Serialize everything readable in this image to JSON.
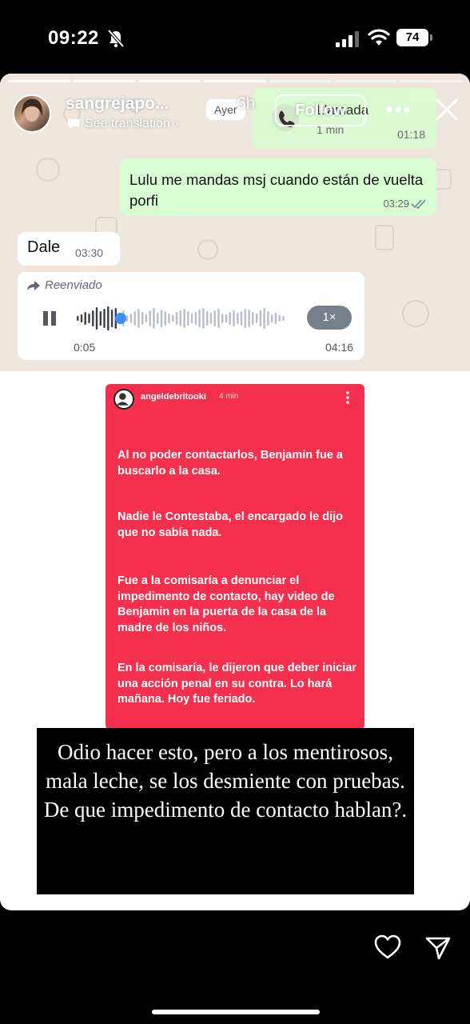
{
  "status_bar": {
    "time": "09:22",
    "battery": "74"
  },
  "story": {
    "progress_segments": [
      {
        "done": true
      },
      {
        "done": true
      },
      {
        "done": true
      },
      {
        "done": true
      },
      {
        "done": false
      },
      {
        "done": false
      },
      {
        "done": false
      }
    ],
    "header": {
      "username": "sangrejapo...",
      "time_ago": "6h",
      "see_translation": "See translation",
      "follow_label": "Follow"
    }
  },
  "whatsapp": {
    "date_chip": "Ayer",
    "call": {
      "title": "Llamada",
      "duration": "1 min",
      "time": "01:18"
    },
    "outgoing_message": {
      "text": "Lulu me mandas msj cuando están de vuelta porfi",
      "time": "03:29"
    },
    "incoming_message": {
      "text": "Dale",
      "time": "03:30"
    },
    "voice_note": {
      "forwarded_label": "Reenviado",
      "elapsed": "0:05",
      "total": "04:16",
      "speed": "1×",
      "progress": 0.21
    }
  },
  "red_story": {
    "username": "angeldebritooki",
    "time_ago": "4 min",
    "paragraphs": [
      "Al no poder contactarlos, Benjamin fue a buscarlo a la casa.",
      "Nadie le Contestaba, el encargado le dijo que no sabía nada.",
      "Fue a la comisaría a denunciar el impedimento de contacto, hay video de Benjamin en la puerta de la casa de la  madre de los niños.",
      "En la comisaría, le dijeron que deber iniciar una acción penal en su contra. Lo hará mañana. Hoy fue feriado."
    ]
  },
  "caption": {
    "text": "Odio hacer esto, pero a los mentirosos, mala leche, se los desmiente con pruebas. De que impedimento de contacto hablan?."
  },
  "footer": {
    "icons": [
      "heart-icon",
      "send-icon"
    ]
  },
  "colors": {
    "red_story_bg": "#f5304e",
    "wa_outgoing": "#d9fdd3",
    "wa_bg": "#efe7de",
    "wa_voice_dot": "#3d8ef7"
  }
}
